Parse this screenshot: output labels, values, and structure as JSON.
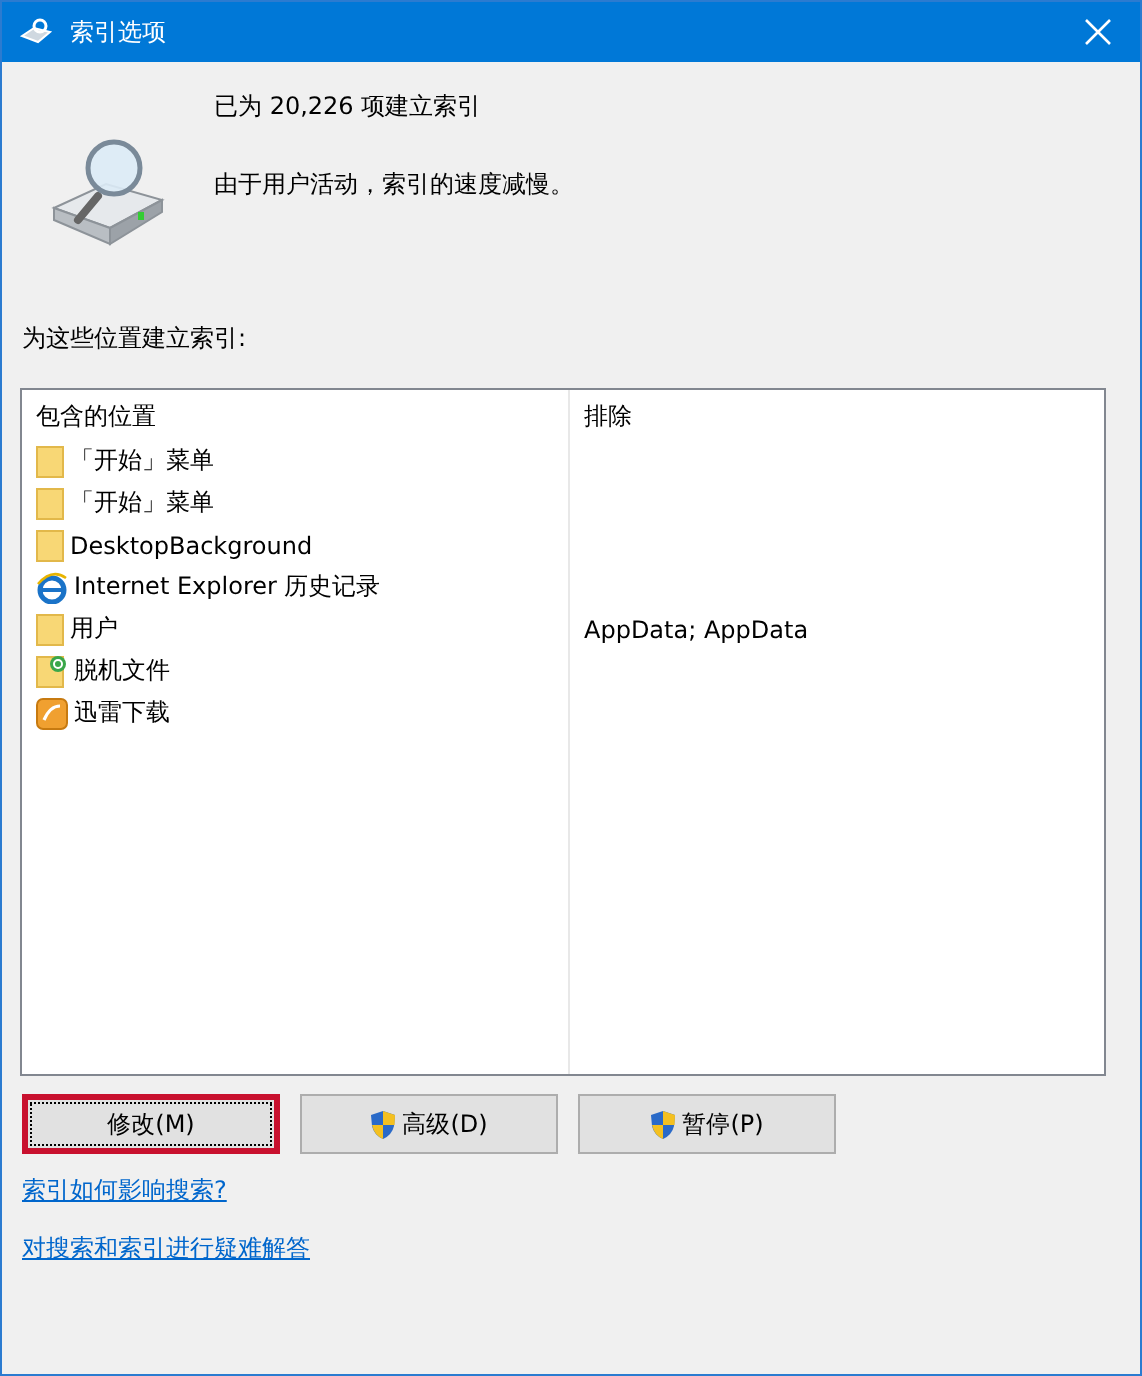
{
  "window": {
    "title": "索引选项"
  },
  "status": {
    "count_line": "已为 20,226 项建立索引",
    "message": "由于用户活动，索引的速度减慢。"
  },
  "locations_label": "为这些位置建立索引:",
  "table": {
    "columns": [
      "包含的位置",
      "排除"
    ],
    "rows": [
      {
        "kind": "folder",
        "location": "「开始」菜单",
        "exclude": ""
      },
      {
        "kind": "folder",
        "location": "「开始」菜单",
        "exclude": ""
      },
      {
        "kind": "folder",
        "location": "DesktopBackground",
        "exclude": ""
      },
      {
        "kind": "browser",
        "location": "Internet Explorer 历史记录",
        "exclude": ""
      },
      {
        "kind": "folder",
        "location": "用户",
        "exclude": "AppData; AppData"
      },
      {
        "kind": "offline",
        "location": "脱机文件",
        "exclude": ""
      },
      {
        "kind": "app",
        "location": "迅雷下载",
        "exclude": ""
      }
    ]
  },
  "buttons": [
    {
      "label": "修改(M)",
      "shield": false,
      "focused": true
    },
    {
      "label": "高级(D)",
      "shield": true,
      "focused": false
    },
    {
      "label": "暂停(P)",
      "shield": true,
      "focused": false
    }
  ],
  "links": [
    "索引如何影响搜索?",
    "对搜索和索引进行疑难解答"
  ]
}
